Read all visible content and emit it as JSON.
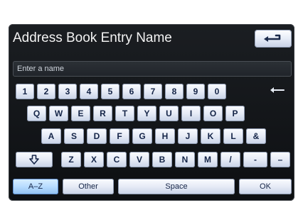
{
  "title": "Address Book Entry Name",
  "entry": {
    "placeholder": "Enter a name"
  },
  "keyboard": {
    "row1": [
      "1",
      "2",
      "3",
      "4",
      "5",
      "6",
      "7",
      "8",
      "9",
      "0"
    ],
    "row2": [
      "Q",
      "W",
      "E",
      "R",
      "T",
      "Y",
      "U",
      "I",
      "O",
      "P"
    ],
    "row3": [
      "A",
      "S",
      "D",
      "F",
      "G",
      "H",
      "J",
      "K",
      "L",
      "&"
    ],
    "row4_shift_icon": "shift-arrow-icon",
    "row4": [
      "Z",
      "X",
      "C",
      "V",
      "B",
      "N",
      "M",
      "/",
      "-",
      "–"
    ],
    "bottom": {
      "az": "A–Z",
      "other": "Other",
      "space": "Space",
      "ok": "OK"
    }
  },
  "icons": {
    "back": "return-arrow-icon",
    "backspace": "left-arrow-icon"
  },
  "colors": {
    "panel_bg": "#111316",
    "key_text": "#142447",
    "title_text": "#f2f2f2"
  }
}
